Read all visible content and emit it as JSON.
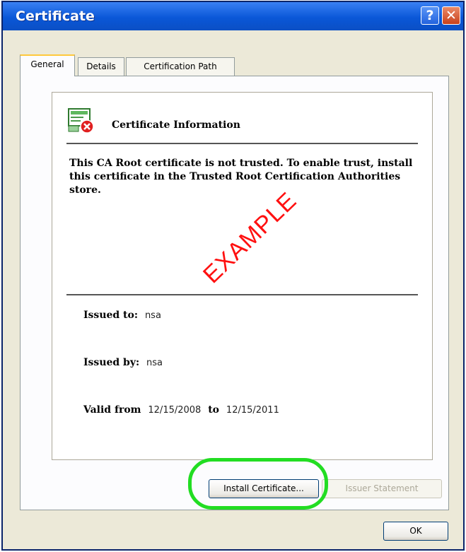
{
  "window": {
    "title": "Certificate",
    "help_glyph": "?",
    "close_glyph": "✕"
  },
  "tabs": [
    {
      "label": "General",
      "active": true
    },
    {
      "label": "Details",
      "active": false
    },
    {
      "label": "Certification Path",
      "active": false
    }
  ],
  "cert": {
    "heading": "Certificate Information",
    "message": "This CA Root certificate is not trusted. To enable trust, install this certificate in the Trusted Root Certification Authorities store.",
    "issued_to_label": "Issued to:",
    "issued_to_value": "nsa",
    "issued_by_label": "Issued by:",
    "issued_by_value": "nsa",
    "valid_from_label": "Valid from",
    "valid_from_value": "12/15/2008",
    "valid_to_label": "to",
    "valid_to_value": "12/15/2011"
  },
  "watermark": "EXAMPLE",
  "buttons": {
    "install": "Install Certificate...",
    "issuer": "Issuer Statement",
    "ok": "OK"
  },
  "colors": {
    "accent": "#22dd22",
    "watermark": "#ff1010",
    "titlebar": "#0a57d8"
  },
  "icons": [
    "certificate-icon",
    "error-icon",
    "help-icon",
    "close-icon"
  ]
}
